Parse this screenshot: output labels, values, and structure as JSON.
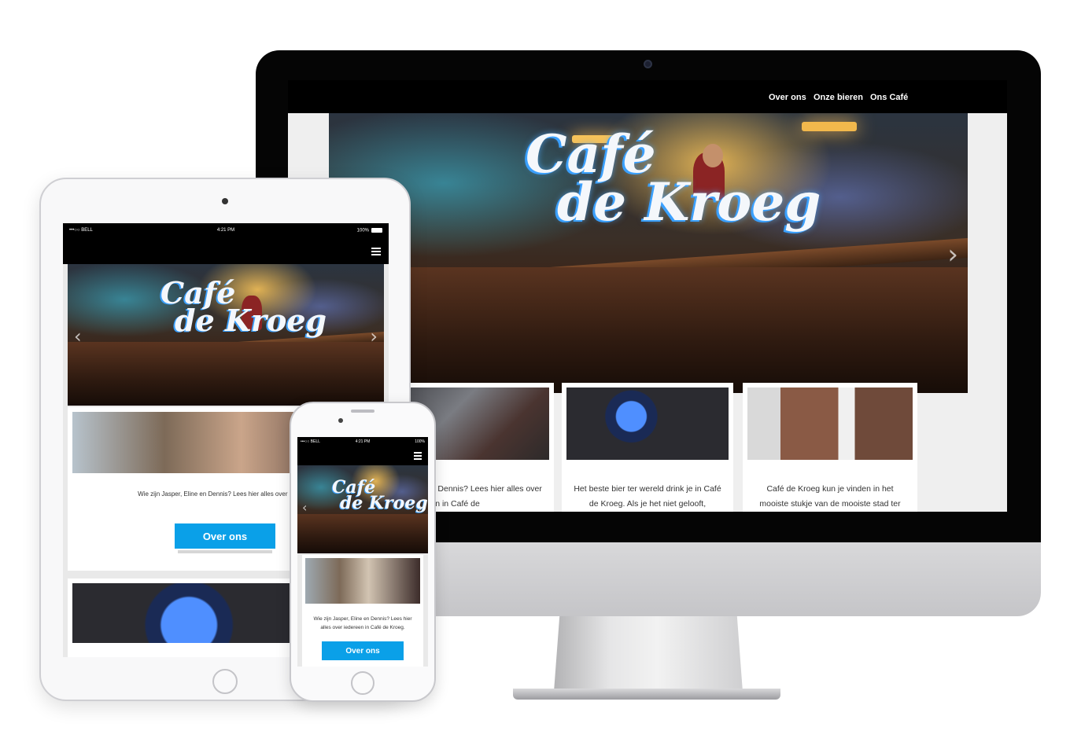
{
  "desktop": {
    "nav": [
      {
        "label": "Over ons"
      },
      {
        "label": "Onze bieren"
      },
      {
        "label": "Ons Café"
      }
    ],
    "hero": {
      "logo_line1": "Café",
      "logo_line2": "de Kroeg",
      "arrow_right": "›"
    },
    "cards": [
      {
        "text": "Wie zijn Jasper, Eline en Dennis? Lees hier alles over iedereen in Café de"
      },
      {
        "text": "Het beste bier ter wereld drink je in Café de Kroeg. Als je het niet gelooft,"
      },
      {
        "text": "Café de Kroeg kun je vinden in het mooiste stukje van de mooiste stad ter"
      }
    ]
  },
  "tablet": {
    "status": {
      "carrier": "•••○○ BELL",
      "time": "4:21 PM",
      "battery": "100%"
    },
    "hero": {
      "logo_line1": "Café",
      "logo_line2": "de Kroeg",
      "arrow_left": "‹",
      "arrow_right": "›"
    },
    "card": {
      "text": "Wie zijn Jasper, Eline en Dennis? Lees hier alles over iedereen",
      "button": "Over ons"
    }
  },
  "phone": {
    "status": {
      "carrier": "•••○○ BELL",
      "time": "4:21 PM",
      "battery": "100%"
    },
    "hero": {
      "logo_line1": "Café",
      "logo_line2": "de Kroeg",
      "arrow_left": "‹",
      "arrow_right": "›"
    },
    "card": {
      "text": "Wie zijn Jasper, Eline en Dennis? Lees hier alles over iedereen in Café de Kroeg.",
      "button": "Over ons"
    }
  },
  "colors": {
    "accent": "#0aa0e8",
    "navbar": "#000000",
    "page_bg": "#efefef"
  }
}
